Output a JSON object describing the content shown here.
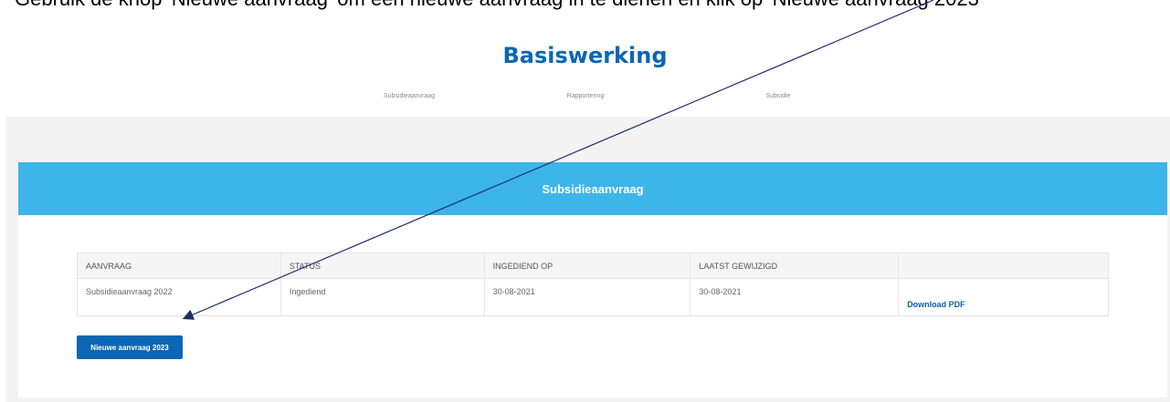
{
  "caption": "Gebruik de knop 'Nieuwe aanvraag' om een nieuwe aanvraag in te dienen en klik op 'Nieuwe aanvraag 2023'",
  "page": {
    "title": "Basiswerking"
  },
  "nav": [
    {
      "label": "Subsidieaanvraag"
    },
    {
      "label": "Rapportering"
    },
    {
      "label": "Subsidie"
    }
  ],
  "card": {
    "title": "Subsidieaanvraag"
  },
  "table": {
    "headers": [
      "AANVRAAG",
      "STATUS",
      "INGEDIEND OP",
      "LAATST GEWIJZIGD",
      ""
    ],
    "rows": [
      {
        "aanvraag": "Subsidieaanvraag 2022",
        "status": "Ingediend",
        "ingediend_op": "30-08-2021",
        "laatst_gewijzigd": "30-08-2021",
        "action": "Download PDF"
      }
    ]
  },
  "button": {
    "label": "Nieuwe aanvraag 2023"
  },
  "colors": {
    "primary": "#0b67b3",
    "header": "#3db5e8",
    "panel": "#f3f3f3",
    "arrow": "#1a2f6b"
  }
}
